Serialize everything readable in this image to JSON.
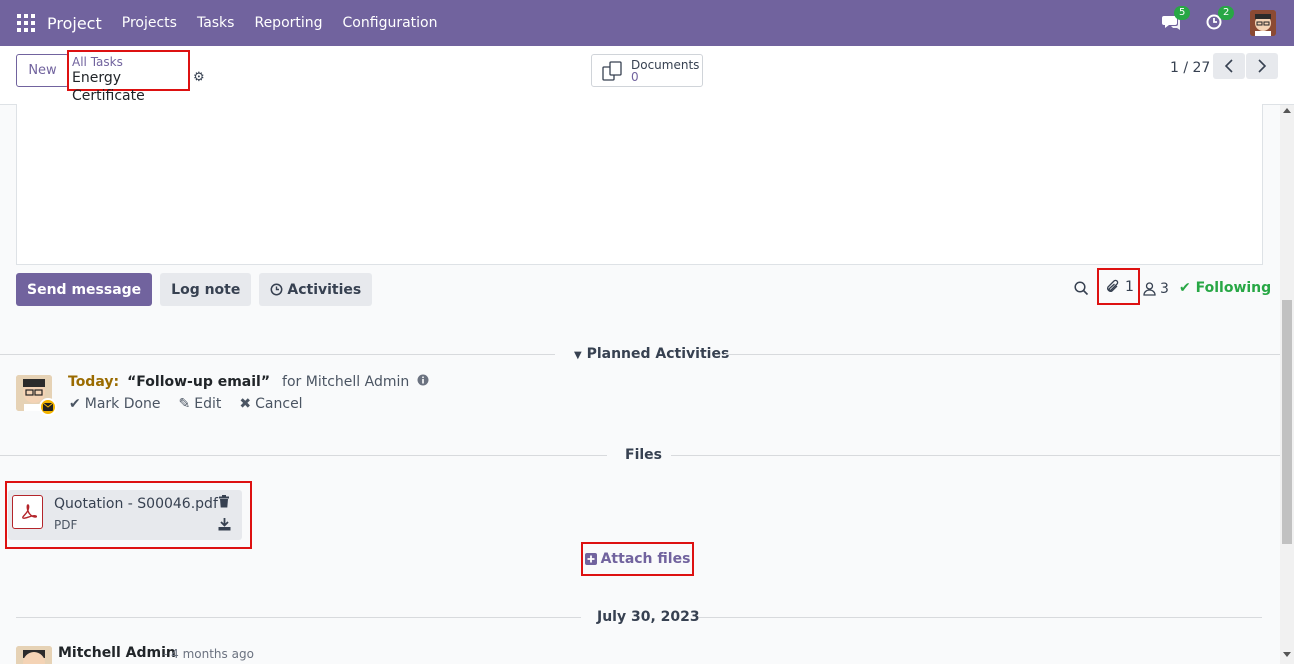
{
  "navbar": {
    "brand": "Project",
    "menu": [
      "Projects",
      "Tasks",
      "Reporting",
      "Configuration"
    ],
    "messages_count": "5",
    "activities_count": "2"
  },
  "control": {
    "new_label": "New",
    "breadcrumb_parent": "All Tasks",
    "breadcrumb_current": "Energy Certificate",
    "documents_label": "Documents",
    "documents_count": "0",
    "pager": "1 / 27"
  },
  "chatter": {
    "send_message": "Send message",
    "log_note": "Log note",
    "activities": "Activities",
    "attachments_count": "1",
    "followers_count": "3",
    "following": "Following"
  },
  "planned": {
    "header": "Planned Activities",
    "today": "Today:",
    "title": "“Follow-up email”",
    "for": "for Mitchell Admin",
    "mark_done": "Mark Done",
    "edit": "Edit",
    "cancel": "Cancel"
  },
  "files": {
    "header": "Files",
    "name": "Quotation - S00046.pdf",
    "type": "PDF",
    "attach_label": "Attach files"
  },
  "messages": {
    "date": "July 30, 2023",
    "author": "Mitchell Admin",
    "time": "- 4 months ago"
  },
  "colors": {
    "brand": "#71639e",
    "highlight": "#dd1111",
    "following": "#28a745"
  }
}
